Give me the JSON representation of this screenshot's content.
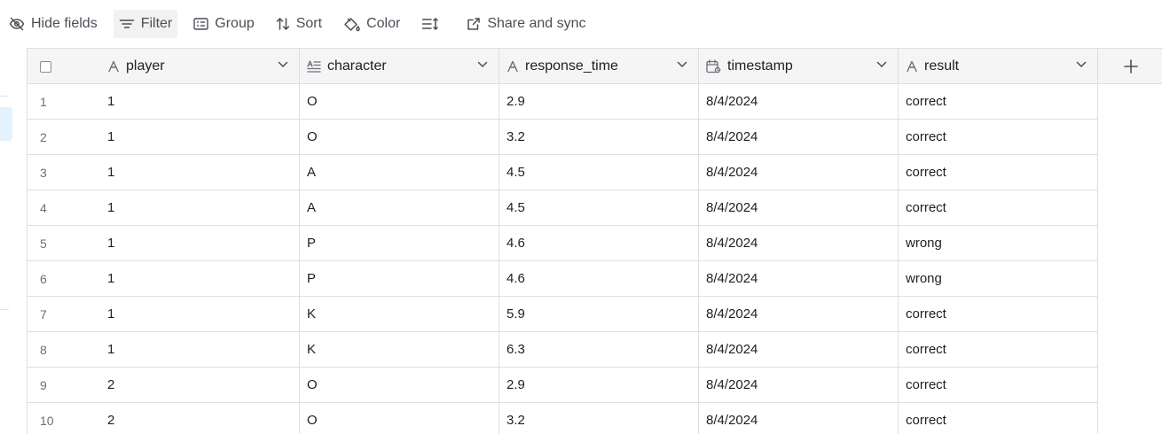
{
  "toolbar": {
    "hide_fields": "Hide fields",
    "filter": "Filter",
    "group": "Group",
    "sort": "Sort",
    "color": "Color",
    "share": "Share and sync"
  },
  "columns": [
    {
      "label": "player",
      "icon": "text-icon"
    },
    {
      "label": "character",
      "icon": "long-text-icon"
    },
    {
      "label": "response_time",
      "icon": "text-icon"
    },
    {
      "label": "timestamp",
      "icon": "date-icon"
    },
    {
      "label": "result",
      "icon": "text-icon"
    }
  ],
  "rows": [
    {
      "n": "1",
      "player": "1",
      "character": "O",
      "response_time": "2.9",
      "timestamp": "8/4/2024",
      "result": "correct"
    },
    {
      "n": "2",
      "player": "1",
      "character": "O",
      "response_time": "3.2",
      "timestamp": "8/4/2024",
      "result": "correct"
    },
    {
      "n": "3",
      "player": "1",
      "character": "A",
      "response_time": "4.5",
      "timestamp": "8/4/2024",
      "result": "correct"
    },
    {
      "n": "4",
      "player": "1",
      "character": "A",
      "response_time": "4.5",
      "timestamp": "8/4/2024",
      "result": "correct"
    },
    {
      "n": "5",
      "player": "1",
      "character": "P",
      "response_time": "4.6",
      "timestamp": "8/4/2024",
      "result": "wrong"
    },
    {
      "n": "6",
      "player": "1",
      "character": "P",
      "response_time": "4.6",
      "timestamp": "8/4/2024",
      "result": "wrong"
    },
    {
      "n": "7",
      "player": "1",
      "character": "K",
      "response_time": "5.9",
      "timestamp": "8/4/2024",
      "result": "correct"
    },
    {
      "n": "8",
      "player": "1",
      "character": "K",
      "response_time": "6.3",
      "timestamp": "8/4/2024",
      "result": "correct"
    },
    {
      "n": "9",
      "player": "2",
      "character": "O",
      "response_time": "2.9",
      "timestamp": "8/4/2024",
      "result": "correct"
    },
    {
      "n": "10",
      "player": "2",
      "character": "O",
      "response_time": "3.2",
      "timestamp": "8/4/2024",
      "result": "correct"
    }
  ]
}
